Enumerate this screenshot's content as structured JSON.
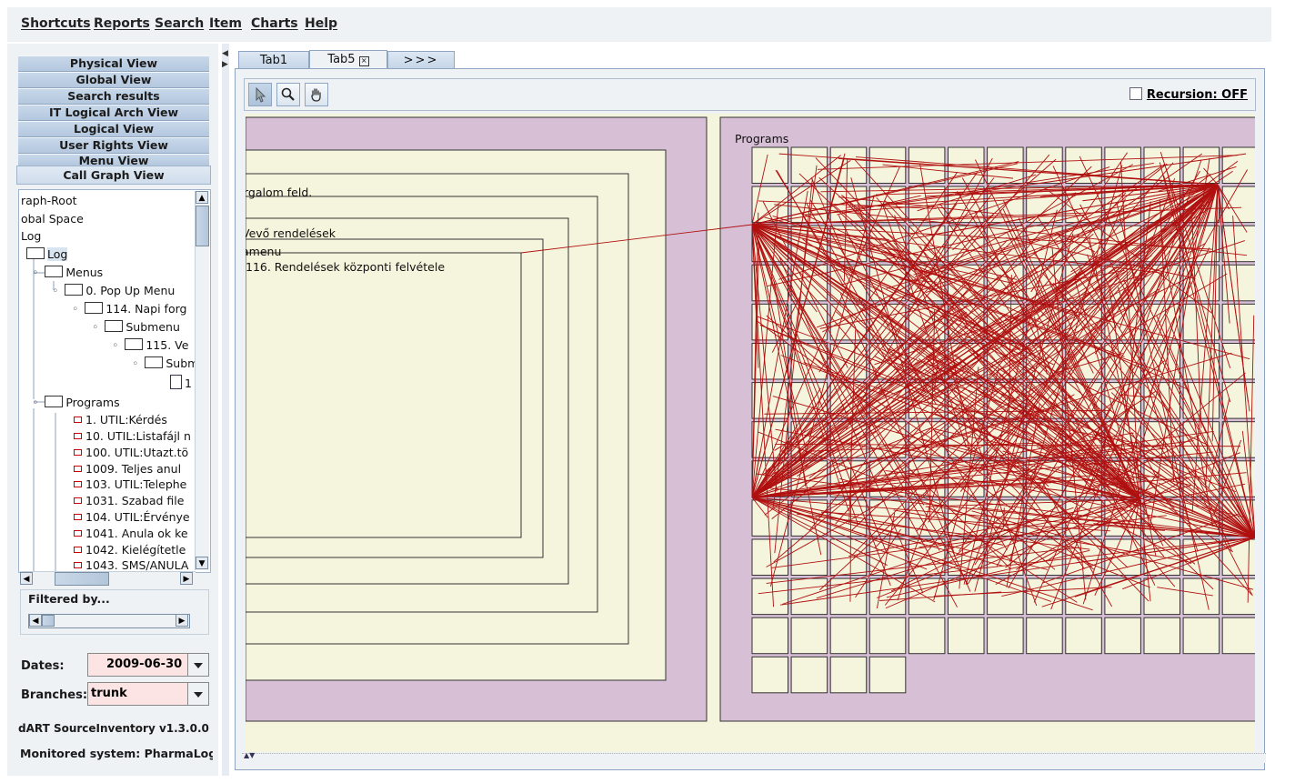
{
  "menubar": {
    "items": [
      "Shortcuts",
      "Reports",
      "Search",
      "Item",
      "Charts",
      "Help"
    ]
  },
  "views": {
    "items": [
      "Physical View",
      "Global View",
      "Search results",
      "IT Logical Arch View",
      "Logical View",
      "User Rights View",
      "Menu View"
    ],
    "active": "Call Graph View"
  },
  "tree": {
    "rows": [
      "raph-Root",
      "obal Space",
      "Log",
      "Log",
      "Menus",
      "0. Pop Up Menu",
      "114. Napi forg",
      "Submenu",
      "115. Ve",
      "Subm",
      "1",
      "Programs",
      "1. UTIL:Kérdés",
      "10. UTIL:Listafájl n",
      "100. UTIL:Utazt.tö",
      "1009. Teljes anul",
      "103. UTIL:Telephe",
      "1031. Szabad file",
      "104. UTIL:Érvénye",
      "1041. Anula ok ke",
      "1042. Kielégítetle",
      "1043. SMS/ANULA"
    ]
  },
  "filter": {
    "label": "Filtered by..."
  },
  "dates": {
    "label": "Dates:",
    "value": "2009-06-30"
  },
  "branches": {
    "label": "Branches:",
    "value": "trunk"
  },
  "footer": {
    "version": "dART SourceInventory v1.3.0.0 (",
    "monitored": "Monitored system: PharmaLog"
  },
  "tabs": {
    "tab1": "Tab1",
    "tab5": "Tab5",
    "more": ">>>"
  },
  "toolbar": {
    "recursion_label": "Recursion: OFF",
    "tools": [
      "pointer-icon",
      "zoom-icon",
      "hand-icon"
    ]
  },
  "graph": {
    "nested_labels": [
      "rgalom feld.",
      "Vevő rendelések",
      "amenu",
      "116. Rendelések központi felvétele"
    ],
    "programs_label": "Programs"
  },
  "colors": {
    "panel_bg": "#eef2f5",
    "canvas_bg": "#f5f4dc",
    "group_bg": "#d7bfd6",
    "edge": "#b01010",
    "combo_bg": "#fde4e4"
  }
}
